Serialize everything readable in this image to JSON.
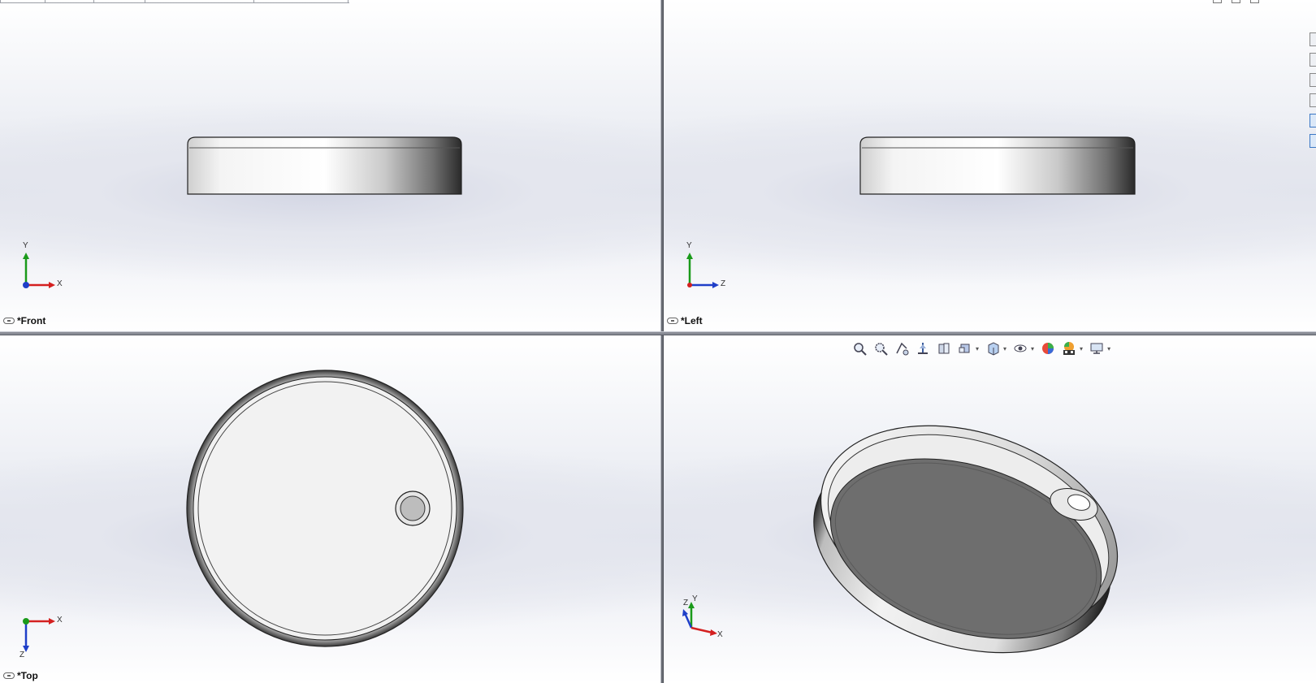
{
  "viewports": {
    "front": {
      "label": "*Front",
      "axes": [
        "Y",
        "X"
      ]
    },
    "left": {
      "label": "*Left",
      "axes": [
        "Y",
        "Z"
      ]
    },
    "top": {
      "label": "*Top",
      "axes": [
        "X",
        "Z"
      ]
    },
    "iso": {
      "label": "",
      "axes": [
        "Y",
        "Z",
        "X"
      ]
    }
  },
  "view_toolbar": {
    "icons": [
      "zoom-to-fit-icon",
      "zoom-to-area-icon",
      "previous-view-icon",
      "section-view-icon",
      "dynamic-annotation-icon",
      "view-orientation-icon",
      "display-style-icon",
      "hide-show-items-icon",
      "edit-appearance-icon",
      "apply-scene-icon",
      "view-settings-icon"
    ]
  },
  "colors": {
    "axis_x": "#d42020",
    "axis_y": "#1a9a1a",
    "axis_z": "#1f3fc8",
    "part_inner": "#6e6e6e"
  }
}
